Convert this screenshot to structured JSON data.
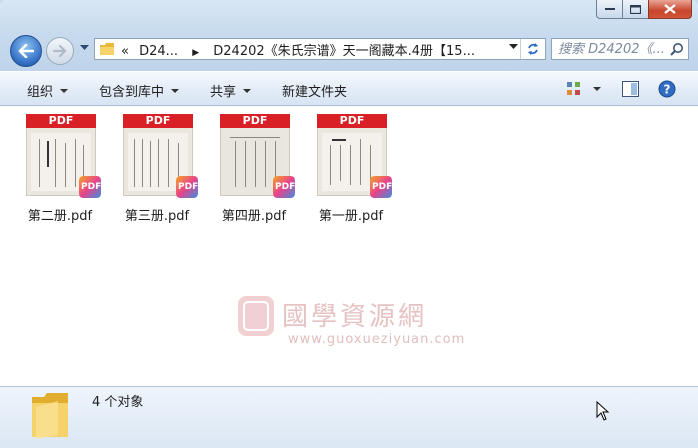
{
  "window": {
    "caption_buttons": [
      "minimize",
      "maximize",
      "close"
    ]
  },
  "address": {
    "breadcrumb_root": "D24...",
    "breadcrumb_current": "D24202《朱氏宗谱》天一阁藏本.4册【15..."
  },
  "search": {
    "placeholder": "搜索 D24202《..."
  },
  "toolbar": {
    "organize": "组织",
    "include_in_library": "包含到库中",
    "share": "共享",
    "new_folder": "新建文件夹"
  },
  "files": [
    {
      "name": "第二册.pdf",
      "band": "PDF",
      "badge": "PDF"
    },
    {
      "name": "第三册.pdf",
      "band": "PDF",
      "badge": "PDF"
    },
    {
      "name": "第四册.pdf",
      "band": "PDF",
      "badge": "PDF"
    },
    {
      "name": "第一册.pdf",
      "band": "PDF",
      "badge": "PDF"
    }
  ],
  "watermark": {
    "text": "國學資源網",
    "url": "www.guoxueziyuan.com"
  },
  "status": {
    "count_text": "4 个对象"
  },
  "colors": {
    "pdf_red": "#d92027",
    "folder_yellow": "#f2c94c",
    "accent_blue": "#2f6cc2"
  }
}
